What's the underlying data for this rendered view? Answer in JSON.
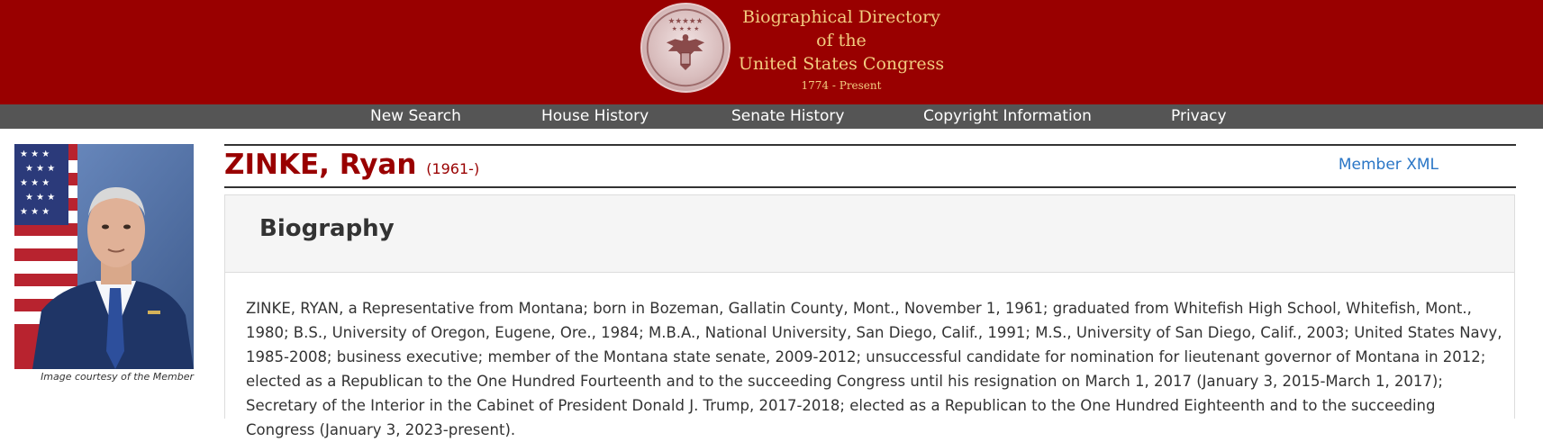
{
  "header": {
    "title_lines": [
      "Biographical Directory",
      "of the",
      "United States Congress"
    ],
    "years": "1774 - Present",
    "seal_icon": "great-seal-eagle"
  },
  "nav": {
    "items": [
      {
        "label": "New Search"
      },
      {
        "label": "House History"
      },
      {
        "label": "Senate History"
      },
      {
        "label": "Copyright Information"
      },
      {
        "label": "Privacy"
      }
    ]
  },
  "member": {
    "name": "ZINKE, Ryan",
    "dates": "(1961-)",
    "xml_link": "Member XML",
    "photo_caption": "Image courtesy of the Member"
  },
  "biography": {
    "heading": "Biography",
    "text": "ZINKE, RYAN, a Representative from Montana; born in Bozeman, Gallatin County, Mont., November 1, 1961; graduated from Whitefish High School, Whitefish, Mont., 1980; B.S., University of Oregon, Eugene, Ore., 1984; M.B.A., National University, San Diego, Calif., 1991; M.S., University of San Diego, Calif., 2003; United States Navy, 1985-2008; business executive; member of the Montana state senate, 2009-2012; unsuccessful candidate for nomination for lieutenant governor of Montana in 2012; elected as a Republican to the One Hundred Fourteenth and to the succeeding Congress until his resignation on March 1, 2017 (January 3, 2015-March 1, 2017); Secretary of the Interior in the Cabinet of President Donald J. Trump, 2017-2018; elected as a Republican to the One Hundred Eighteenth and to the succeeding Congress (January 3, 2023-present)."
  },
  "colors": {
    "header_bg": "#990000",
    "nav_bg": "#555555",
    "title_gold": "#f2cc80",
    "name_red": "#990000",
    "link_blue": "#2a76c6"
  }
}
